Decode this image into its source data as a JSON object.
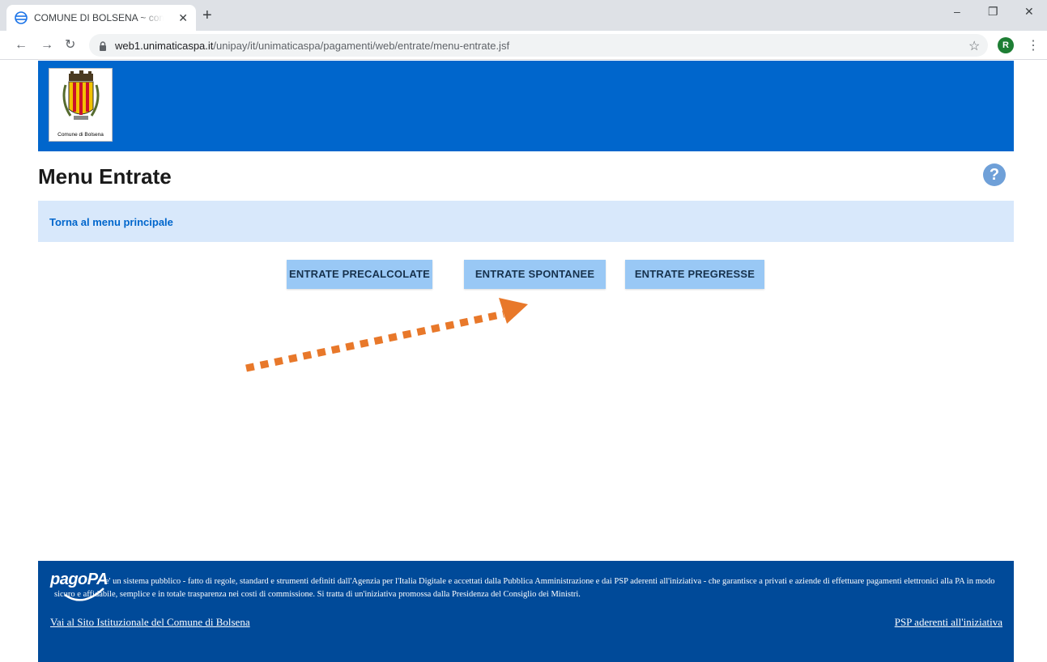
{
  "browser": {
    "tab_title": "COMUNE DI BOLSENA ~ combo",
    "tab_close": "✕",
    "new_tab": "+",
    "url_host": "web1.unimaticaspa.it",
    "url_path": "/unipay/it/unimaticaspa/pagamenti/web/entrate/menu-entrate.jsf",
    "profile_initial": "R",
    "minimize": "–",
    "restore": "❐",
    "close": "✕"
  },
  "header": {
    "logo_caption": "Comune di Bolsena"
  },
  "page": {
    "title": "Menu Entrate",
    "help": "?",
    "back_link": "Torna al menu principale"
  },
  "buttons": {
    "precalcolate": "ENTRATE PRECALCOLATE",
    "spontanee": "ENTRATE SPONTANEE",
    "pregresse": "ENTRATE PREGRESSE"
  },
  "footer": {
    "brand": "pagoPA",
    "description": "e' un sistema pubblico - fatto di regole, standard e strumenti definiti dall'Agenzia per l'Italia Digitale e accettati dalla Pubblica Amministrazione e dai PSP aderenti all'iniziativa - che garantisce a privati e aziende di effettuare pagamenti elettronici alla PA in modo sicuro e affidabile, semplice e in totale trasparenza nei costi di commissione. Si tratta di un'iniziativa promossa dalla Presidenza del Consiglio dei Ministri.",
    "link_left": "Vai al Sito Istituzionale del Comune di Bolsena",
    "link_right": "PSP aderenti all'iniziativa"
  },
  "colors": {
    "header_blue": "#0066cc",
    "footer_blue": "#004a99",
    "button_bg": "#99c8f5",
    "annotation_arrow": "#e8782a"
  }
}
